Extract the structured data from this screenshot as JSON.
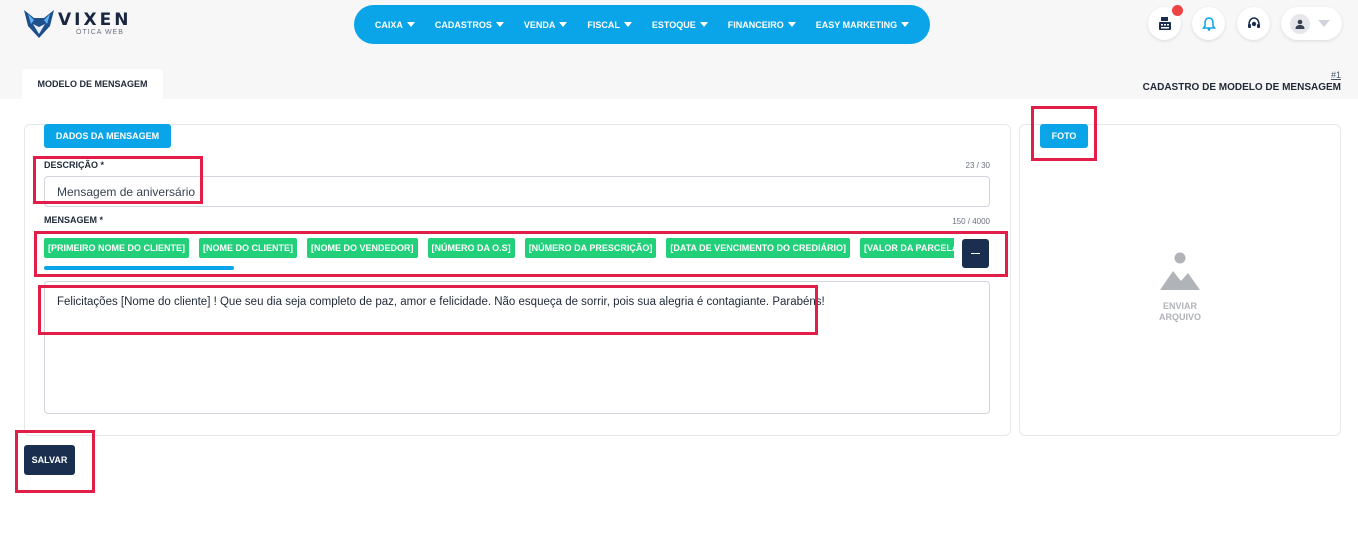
{
  "logo": {
    "name": "VIXEN",
    "subtitle": "ÓTICA WEB"
  },
  "nav": {
    "items": [
      {
        "label": "CAIXA"
      },
      {
        "label": "CADASTROS"
      },
      {
        "label": "VENDA"
      },
      {
        "label": "FISCAL"
      },
      {
        "label": "ESTOQUE"
      },
      {
        "label": "FINANCEIRO"
      },
      {
        "label": "EASY MARKETING"
      }
    ]
  },
  "header_icons": [
    "cash-register-icon",
    "bell-icon",
    "support-headset-icon",
    "user-icon"
  ],
  "tab": {
    "label": "MODELO DE MENSAGEM"
  },
  "page": {
    "number": "#1",
    "title": "CADASTRO DE MODELO DE MENSAGEM"
  },
  "form": {
    "section_button": "DADOS DA MENSAGEM",
    "descricao": {
      "label": "DESCRIÇÃO *",
      "value": "Mensagem de aniversário",
      "counter": "23 / 30"
    },
    "mensagem": {
      "label": "MENSAGEM *",
      "counter": "150 / 4000",
      "tags": [
        "[PRIMEIRO NOME DO CLIENTE]",
        "[NOME DO CLIENTE]",
        "[NOME DO VENDEDOR]",
        "[NÚMERO DA O.S]",
        "[NÚMERO DA PRESCRIÇÃO]",
        "[DATA DE VENCIMENTO DO CREDIÁRIO]",
        "[VALOR DA PARCELA DO CREDIÁRIO]"
      ],
      "value": "Felicitações [Nome do cliente] ! Que seu dia seja completo de paz, amor e felicidade. Não esqueça de sorrir, pois sua alegria é contagiante. Parabéns!"
    }
  },
  "photo": {
    "button": "FOTO",
    "upload_line1": "ENVIAR",
    "upload_line2": "ARQUIVO"
  },
  "actions": {
    "save": "SALVAR"
  },
  "colors": {
    "primary": "#0aa4e8",
    "dark": "#1a2f4f",
    "tag": "#22d07a",
    "highlight": "#e11d48",
    "notification": "#ef4444"
  }
}
